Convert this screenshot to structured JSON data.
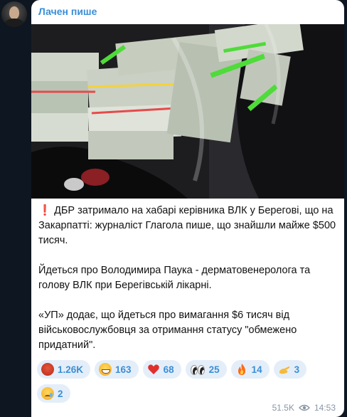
{
  "channel": {
    "name": "Лачен пише"
  },
  "post": {
    "paragraphs": [
      "ДБР затримало на хабарі керівника ВЛК у Берегові, що на Закарпатті: журналіст Глагола пише, що знайшли майже $500 тисяч.",
      "Йдеться про Володимира Паука - дерматовенеролога та голову ВЛК при Берегівській лікарні.",
      "«УП» додає, що йдеться про вимагання $6 тисяч від військовослужбовця за отримання статусу \"обмежено придатний\"."
    ],
    "alert_icon": "red-exclamation-icon"
  },
  "reactions": [
    {
      "emoji": "angry-face-icon",
      "count": "1.26K"
    },
    {
      "emoji": "grinning-face-icon",
      "count": "163"
    },
    {
      "emoji": "red-heart-icon",
      "count": "68"
    },
    {
      "emoji": "eyes-icon",
      "count": "25"
    },
    {
      "emoji": "fire-icon",
      "count": "14"
    },
    {
      "emoji": "pinching-hand-icon",
      "count": "3"
    },
    {
      "emoji": "crying-face-icon",
      "count": "2"
    }
  ],
  "meta": {
    "views": "51.5K",
    "time": "14:53"
  },
  "colors": {
    "accent": "#3a8fd6",
    "chat_bg": "#0e1621",
    "reaction_bg": "#e4eef9"
  }
}
